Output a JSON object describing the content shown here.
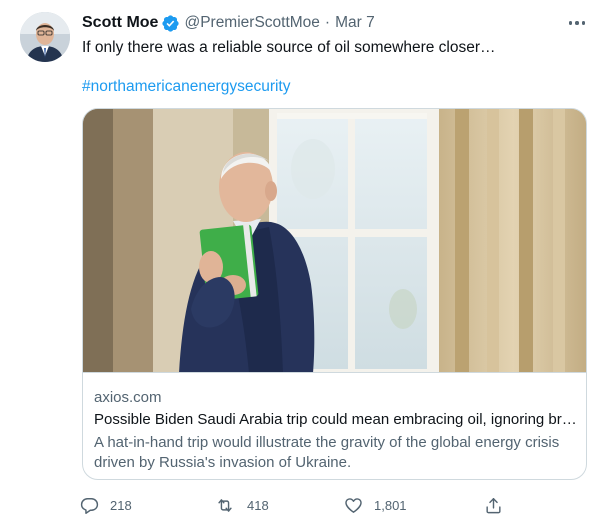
{
  "tweet": {
    "display_name": "Scott Moe",
    "verified": true,
    "handle": "@PremierScottMoe",
    "separator": "·",
    "date": "Mar 7",
    "text": "If only there was a reliable source of oil somewhere closer…",
    "hashtag": "#northamericanenergysecurity"
  },
  "card": {
    "domain": "axios.com",
    "title": "Possible Biden Saudi Arabia trip could mean embracing oil, ignoring br…",
    "description": "A hat-in-hand trip would illustrate the gravity of the global energy crisis driven by Russia's invasion of Ukraine."
  },
  "actions": {
    "replies": "218",
    "retweets": "418",
    "likes": "1,801"
  },
  "icons": {
    "verified": "verified-badge-icon",
    "more": "more-horizontal-icon",
    "reply": "reply-icon",
    "retweet": "retweet-icon",
    "like": "heart-icon",
    "share": "share-icon"
  },
  "colors": {
    "accent": "#1d9bf0",
    "text": "#0f1419",
    "secondary": "#536471",
    "border": "#cfd9de"
  }
}
